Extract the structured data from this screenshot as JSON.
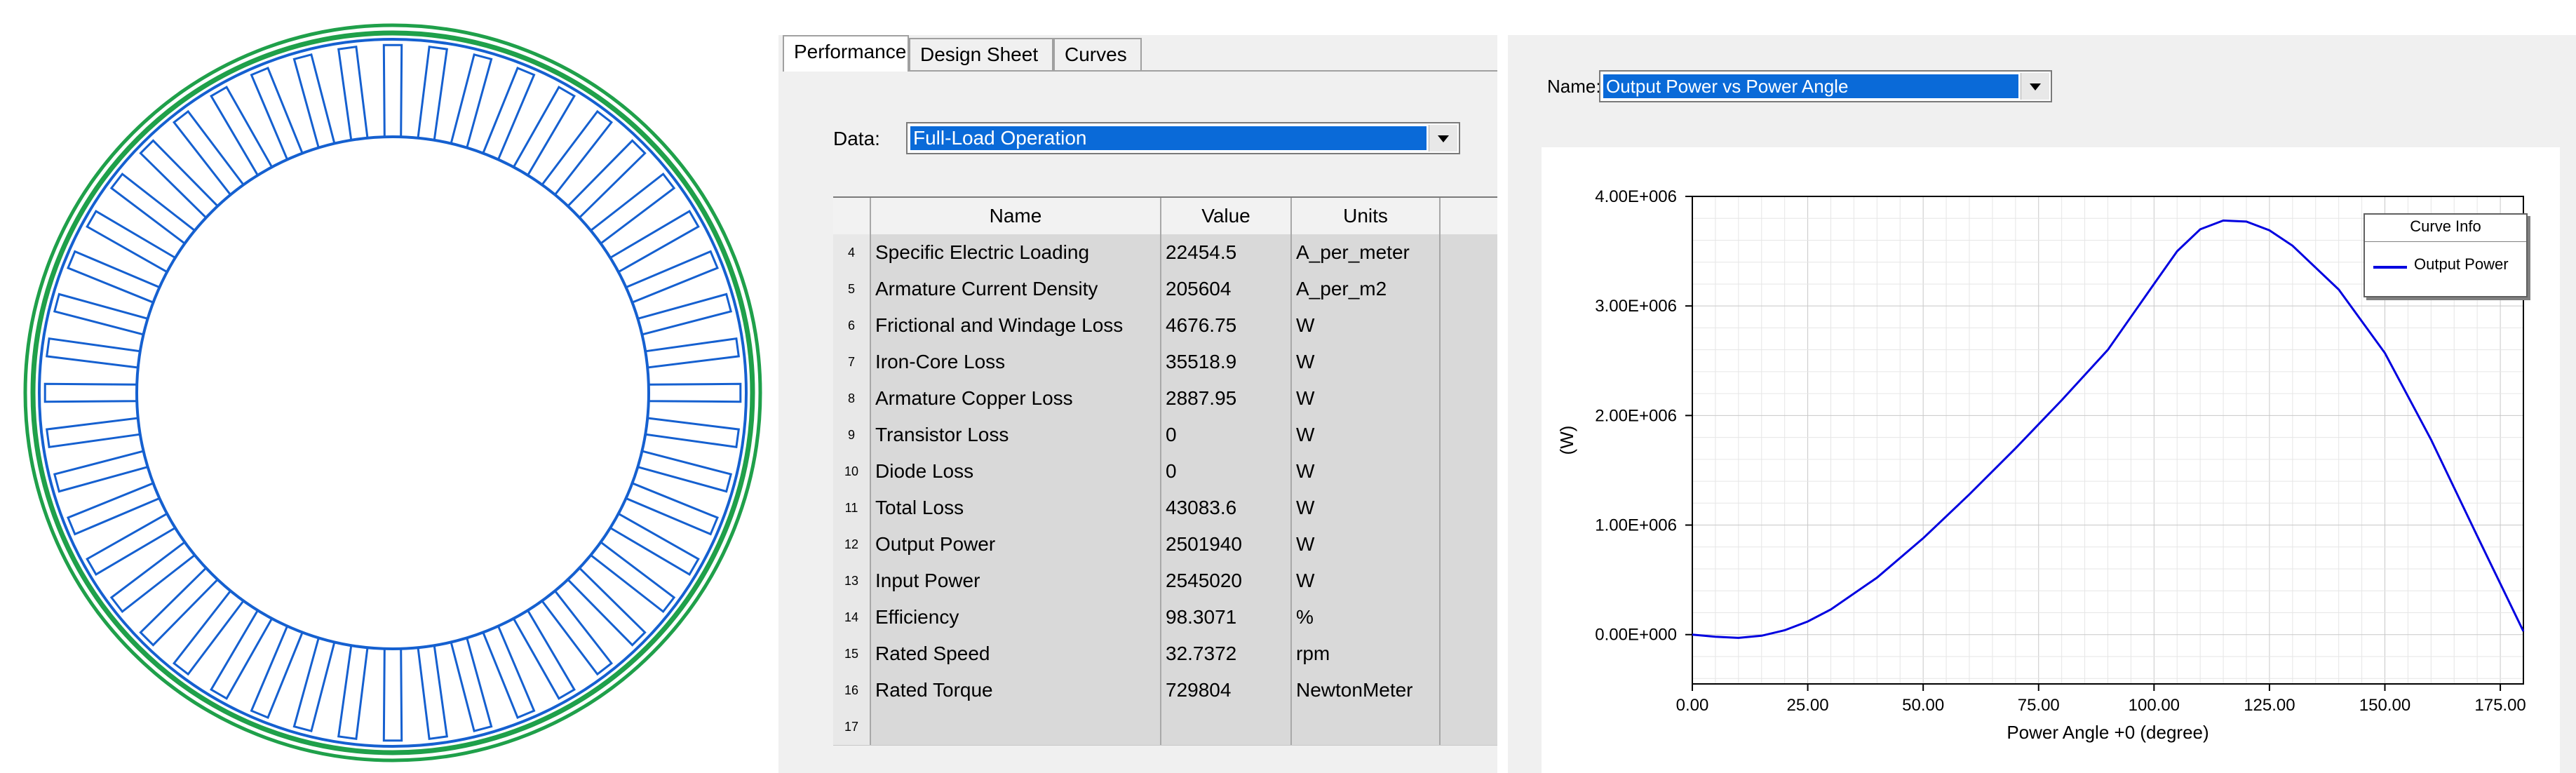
{
  "tabs": [
    {
      "label": "Performance",
      "active": true
    },
    {
      "label": "Design Sheet",
      "active": false
    },
    {
      "label": "Curves",
      "active": false
    }
  ],
  "data_field": {
    "label": "Data:",
    "value": "Full-Load Operation"
  },
  "table": {
    "headers": [
      "Name",
      "Value",
      "Units"
    ],
    "rows": [
      {
        "index": "4",
        "name": "Specific Electric Loading",
        "value": "22454.5",
        "units": "A_per_meter"
      },
      {
        "index": "5",
        "name": "Armature Current Density",
        "value": "205604",
        "units": "A_per_m2"
      },
      {
        "index": "6",
        "name": "Frictional and Windage Loss",
        "value": "4676.75",
        "units": "W"
      },
      {
        "index": "7",
        "name": "Iron-Core Loss",
        "value": "35518.9",
        "units": "W"
      },
      {
        "index": "8",
        "name": "Armature Copper Loss",
        "value": "2887.95",
        "units": "W"
      },
      {
        "index": "9",
        "name": "Transistor Loss",
        "value": "0",
        "units": "W"
      },
      {
        "index": "10",
        "name": "Diode Loss",
        "value": "0",
        "units": "W"
      },
      {
        "index": "11",
        "name": "Total Loss",
        "value": "43083.6",
        "units": "W"
      },
      {
        "index": "12",
        "name": "Output Power",
        "value": "2501940",
        "units": "W"
      },
      {
        "index": "13",
        "name": "Input Power",
        "value": "2545020",
        "units": "W"
      },
      {
        "index": "14",
        "name": "Efficiency",
        "value": "98.3071",
        "units": "%"
      },
      {
        "index": "15",
        "name": "Rated Speed",
        "value": "32.7372",
        "units": "rpm"
      },
      {
        "index": "16",
        "name": "Rated Torque",
        "value": "729804",
        "units": "NewtonMeter"
      },
      {
        "index": "17",
        "name": "",
        "value": "",
        "units": ""
      }
    ]
  },
  "curve_selector": {
    "label": "Name:",
    "value": "Output Power vs Power Angle"
  },
  "colors": {
    "slots": "#1560d0",
    "outer_ring": "#1fa04a",
    "curve": "#0000e0",
    "selection": "#0a6ad8"
  },
  "chart_data": {
    "type": "line",
    "xlabel": "Power Angle +0 (degree)",
    "ylabel": "(W)",
    "xlim": [
      0,
      180
    ],
    "ylim": [
      -450000,
      4000000
    ],
    "x_ticks": [
      "0.00",
      "25.00",
      "50.00",
      "75.00",
      "100.00",
      "125.00",
      "150.00",
      "175.00"
    ],
    "y_ticks": [
      "0.00E+000",
      "1.00E+006",
      "2.00E+006",
      "3.00E+006",
      "4.00E+006"
    ],
    "grid": true,
    "legend_title": "Curve Info",
    "legend_position": "top-right",
    "series": [
      {
        "name": "Output Power",
        "x": [
          0,
          5,
          10,
          15,
          20,
          25,
          30,
          40,
          50,
          60,
          70,
          80,
          90,
          100,
          105,
          110,
          115,
          120,
          125,
          130,
          140,
          150,
          160,
          170,
          180
        ],
        "y": [
          0,
          -20000,
          -30000,
          -10000,
          40000,
          120000,
          230000,
          520000,
          880000,
          1280000,
          1700000,
          2140000,
          2600000,
          3200000,
          3500000,
          3700000,
          3780000,
          3770000,
          3690000,
          3550000,
          3150000,
          2570000,
          1780000,
          900000,
          30000
        ]
      }
    ]
  }
}
